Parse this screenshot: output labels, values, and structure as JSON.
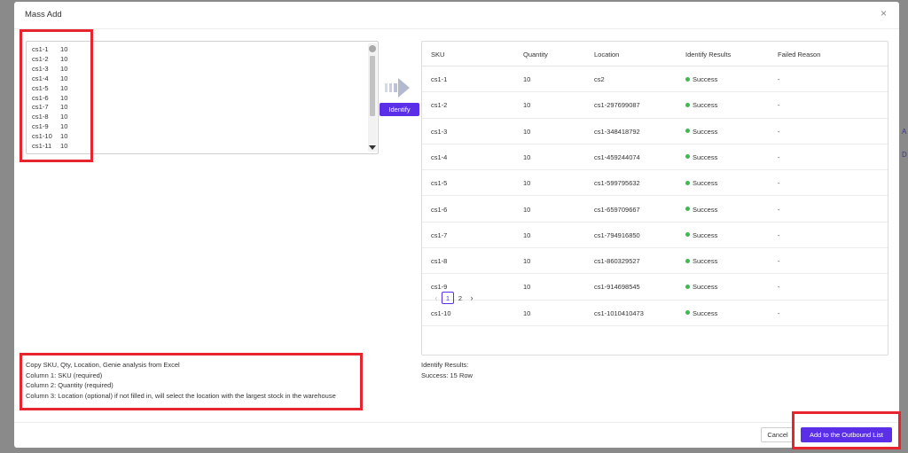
{
  "modal": {
    "title": "Mass Add",
    "close_icon": "×"
  },
  "input": {
    "rows": [
      {
        "sku": "cs1-1",
        "qty": "10"
      },
      {
        "sku": "cs1-2",
        "qty": "10"
      },
      {
        "sku": "cs1-3",
        "qty": "10"
      },
      {
        "sku": "cs1-4",
        "qty": "10"
      },
      {
        "sku": "cs1-5",
        "qty": "10"
      },
      {
        "sku": "cs1-6",
        "qty": "10"
      },
      {
        "sku": "cs1-7",
        "qty": "10"
      },
      {
        "sku": "cs1-8",
        "qty": "10"
      },
      {
        "sku": "cs1-9",
        "qty": "10"
      },
      {
        "sku": "cs1-10",
        "qty": "10"
      },
      {
        "sku": "cs1-11",
        "qty": "10"
      }
    ]
  },
  "identify_button": "Identify",
  "table": {
    "headers": {
      "sku": "SKU",
      "quantity": "Quantity",
      "location": "Location",
      "result": "Identify Results",
      "reason": "Failed Reason"
    },
    "rows": [
      {
        "sku": "cs1-1",
        "qty": "10",
        "location": "cs2",
        "result": "Success",
        "reason": "-"
      },
      {
        "sku": "cs1-2",
        "qty": "10",
        "location": "cs1-297699087",
        "result": "Success",
        "reason": "-"
      },
      {
        "sku": "cs1-3",
        "qty": "10",
        "location": "cs1-348418792",
        "result": "Success",
        "reason": "-"
      },
      {
        "sku": "cs1-4",
        "qty": "10",
        "location": "cs1-459244074",
        "result": "Success",
        "reason": "-"
      },
      {
        "sku": "cs1-5",
        "qty": "10",
        "location": "cs1-599795632",
        "result": "Success",
        "reason": "-"
      },
      {
        "sku": "cs1-6",
        "qty": "10",
        "location": "cs1-659709667",
        "result": "Success",
        "reason": "-"
      },
      {
        "sku": "cs1-7",
        "qty": "10",
        "location": "cs1-794916850",
        "result": "Success",
        "reason": "-"
      },
      {
        "sku": "cs1-8",
        "qty": "10",
        "location": "cs1-860329527",
        "result": "Success",
        "reason": "-"
      },
      {
        "sku": "cs1-9",
        "qty": "10",
        "location": "cs1-914698545",
        "result": "Success",
        "reason": "-"
      },
      {
        "sku": "cs1-10",
        "qty": "10",
        "location": "cs1-1010410473",
        "result": "Success",
        "reason": "-"
      }
    ],
    "status_color": "#3fb950"
  },
  "pagination": {
    "prev_icon": "‹",
    "pages": [
      "1",
      "2"
    ],
    "current": "1",
    "next_icon": "›"
  },
  "instructions": [
    "Copy SKU, Qty, Location, Genie analysis from Excel",
    "Column 1: SKU (required)",
    "Column 2: Quantity (required)",
    "Column 3: Location (optional) if not filled in, will select the location with the largest stock in the warehouse"
  ],
  "results_summary": {
    "label": "Identify Results:",
    "success": "Success: 15 Row"
  },
  "footer": {
    "cancel": "Cancel",
    "add": "Add to the Outbound List"
  },
  "background": {
    "frag_a": "A",
    "frag_d": "D"
  },
  "colors": {
    "accent": "#5b2fe8",
    "highlight": "#e8242f"
  }
}
